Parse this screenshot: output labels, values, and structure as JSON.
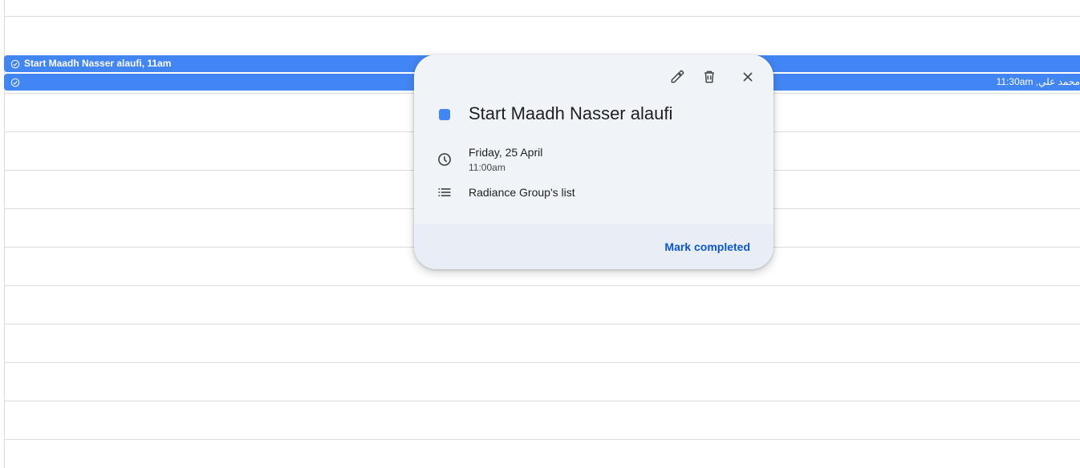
{
  "events": [
    {
      "label": "Start Maadh Nasser alaufi, 11am",
      "right_label": ""
    },
    {
      "label": "",
      "right_label": "11:30am ,محمد علي"
    }
  ],
  "popup": {
    "title": "Start Maadh Nasser alaufi",
    "date": "Friday, 25 April",
    "time": "11:00am",
    "list_name": "Radiance Group's list",
    "mark_completed_label": "Mark completed",
    "color": "#4285f4",
    "icons": {
      "edit": "edit-pencil-icon",
      "delete": "trash-icon",
      "close": "close-icon",
      "time": "clock-icon",
      "list": "list-icon",
      "task": "task-check-icon"
    }
  },
  "colors": {
    "event_bar": "#4285f4",
    "popup_bg": "#f0f4f9",
    "accent_link": "#0b57d0"
  }
}
